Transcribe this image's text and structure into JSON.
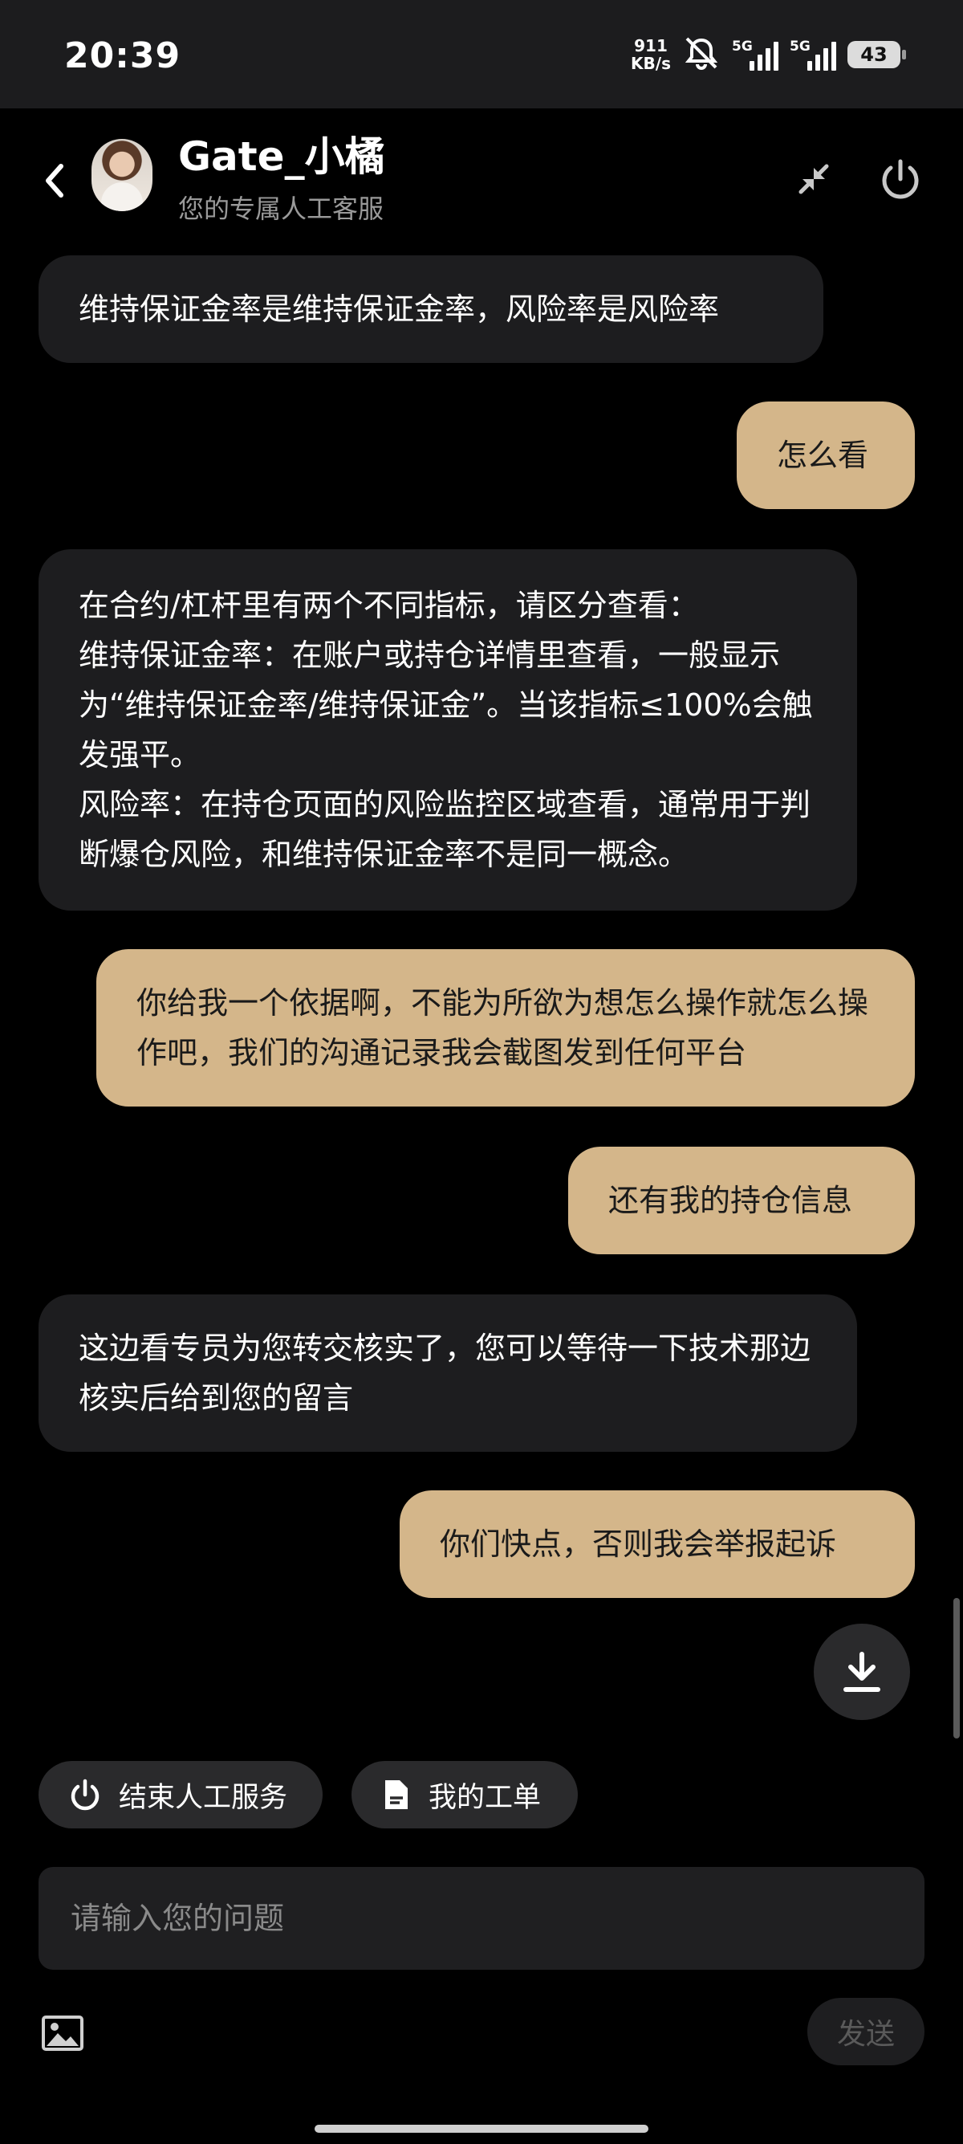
{
  "status_bar": {
    "time": "20:39",
    "net_speed_value": "911",
    "net_speed_unit": "KB/s",
    "sim1_label": "5G",
    "sim2_label": "5G",
    "battery": "43"
  },
  "header": {
    "agent_name": "Gate_小橘",
    "agent_subtitle": "您的专属人工客服"
  },
  "messages": [
    {
      "sender": "agent",
      "text": "维持保证金率是维持保证金率，风险率是风险率"
    },
    {
      "sender": "user",
      "text": "怎么看"
    },
    {
      "sender": "agent",
      "text": "在合约/杠杆里有两个不同指标，请区分查看：\n维持保证金率：在账户或持仓详情里查看，一般显示为“维持保证金率/维持保证金”。当该指标≤100%会触发强平。\n风险率：在持仓页面的风险监控区域查看，通常用于判断爆仓风险，和维持保证金率不是同一概念。"
    },
    {
      "sender": "user",
      "text": "你给我一个依据啊，不能为所欲为想怎么操作就怎么操作吧，我们的沟通记录我会截图发到任何平台"
    },
    {
      "sender": "user",
      "text": "还有我的持仓信息"
    },
    {
      "sender": "agent",
      "text": "这边看专员为您转交核实了，您可以等待一下技术那边核实后给到您的留言"
    },
    {
      "sender": "user",
      "text": "你们快点，否则我会举报起诉"
    }
  ],
  "quick_actions": {
    "end_service": "结束人工服务",
    "my_tickets": "我的工单"
  },
  "composer": {
    "placeholder": "请输入您的问题",
    "send_label": "发送"
  },
  "colors": {
    "user_bubble": "#d4b68a",
    "agent_bubble": "#1d1d1f",
    "background": "#000000"
  }
}
